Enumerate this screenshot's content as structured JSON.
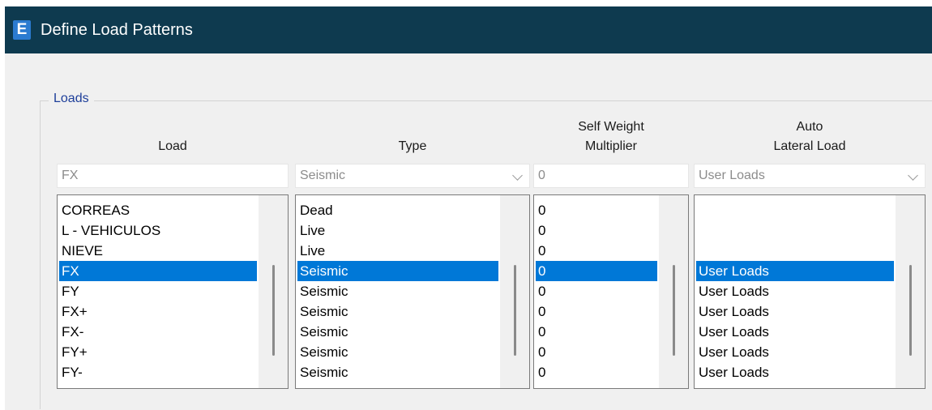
{
  "window": {
    "title": "Define Load Patterns",
    "app_icon_letter": "E",
    "title_bar_color": "#0e3a4f"
  },
  "group": {
    "label": "Loads"
  },
  "columns": {
    "load": {
      "header": "Load",
      "field_value": "FX",
      "items": [
        "CORREAS",
        "L - VEHICULOS",
        "NIEVE",
        "FX",
        "FY",
        "FX+",
        "FX-",
        "FY+",
        "FY-"
      ]
    },
    "type": {
      "header": "Type",
      "field_value": "Seismic",
      "items": [
        "Dead",
        "Live",
        "Live",
        "Seismic",
        "Seismic",
        "Seismic",
        "Seismic",
        "Seismic",
        "Seismic"
      ]
    },
    "self_weight": {
      "header_line1": "Self Weight",
      "header_line2": "Multiplier",
      "field_value": "0",
      "items": [
        "0",
        "0",
        "0",
        "0",
        "0",
        "0",
        "0",
        "0",
        "0"
      ]
    },
    "auto_lateral": {
      "header_line1": "Auto",
      "header_line2": "Lateral Load",
      "field_value": "User Loads",
      "items": [
        "",
        "",
        "",
        "User Loads",
        "User Loads",
        "User Loads",
        "User Loads",
        "User Loads",
        "User Loads"
      ]
    }
  },
  "selected_row_index": 3,
  "colors": {
    "selection": "#0078d7",
    "group_label": "#1e3f9a"
  }
}
